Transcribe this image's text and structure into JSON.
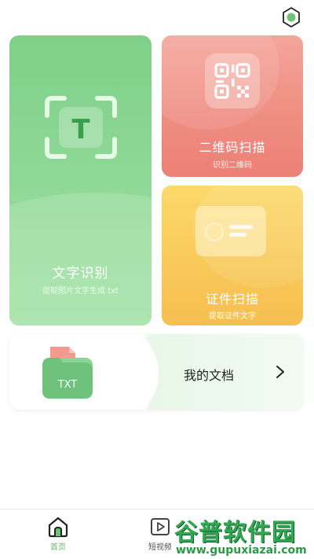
{
  "settings": {
    "icon": "gear-icon"
  },
  "cards": {
    "ocr": {
      "title": "文字识别",
      "subtitle": "提取图片文字生成 txt",
      "icon_letter": "T",
      "color": "#8dd895"
    },
    "qr": {
      "title": "二维码扫描",
      "subtitle": "识别二维码",
      "color": "#ef8c80"
    },
    "id": {
      "title": "证件扫描",
      "subtitle": "提取证件文字",
      "color": "#f8c858"
    },
    "docs": {
      "title": "我的文档",
      "icon_label": "TXT"
    }
  },
  "tabbar": {
    "tabs": [
      {
        "label": "首页",
        "icon": "home-icon",
        "active": true
      },
      {
        "label": "短视频",
        "icon": "play-icon",
        "active": false
      }
    ],
    "accent": "#5cbf6a"
  },
  "watermark": {
    "main": "谷普软件园",
    "sub": "www.gupuxiazai.com"
  }
}
